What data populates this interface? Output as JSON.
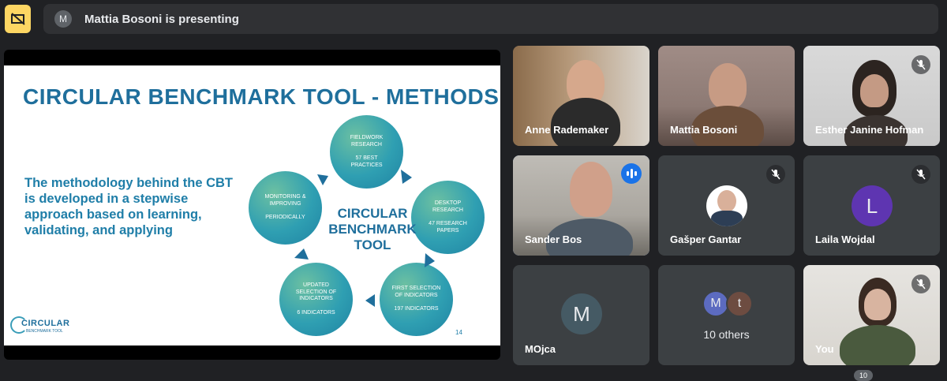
{
  "banner": {
    "avatar_letter": "M",
    "text": "Mattia Bosoni is presenting"
  },
  "slide": {
    "title": "CIRCULAR BENCHMARK TOOL - METHODS",
    "body": "The methodology behind the CBT is developed in a stepwise approach based on learning, validating, and applying",
    "center": [
      "CIRCULAR",
      "BENCHMARK",
      "TOOL"
    ],
    "page_number": "14",
    "logo_text": "CIRCULAR",
    "logo_sub": "BENCHMARK TOOL",
    "circles": {
      "fieldwork": [
        "FIELDWORK",
        "RESEARCH",
        "57 BEST",
        "PRACTICES"
      ],
      "desktop": [
        "DESKTOP",
        "RESEARCH",
        "47 RESEARCH",
        "PAPERS"
      ],
      "first": [
        "FIRST SELECTION",
        "OF INDICATORS",
        "197 INDICATORS"
      ],
      "updated": [
        "UPDATED",
        "SELECTION OF",
        "INDICATORS",
        "6 INDICATORS"
      ],
      "monitoring": [
        "MONITORING &",
        "IMPROVING",
        "PERIODICALLY"
      ]
    }
  },
  "participants": [
    {
      "name": "Anne Rademaker"
    },
    {
      "name": "Mattia Bosoni"
    },
    {
      "name": "Esther Janine Hofman"
    },
    {
      "name": "Sander Bos"
    },
    {
      "name": "Gašper Gantar"
    },
    {
      "name": "Laila Wojdal",
      "avatar_letter": "L",
      "avatar_color": "#5e35b1"
    },
    {
      "name": "MOjca",
      "avatar_letter": "M",
      "avatar_color": "#455a64"
    },
    {
      "name": "10 others",
      "avatars": [
        "M",
        "t"
      ],
      "avatar_colors": [
        "#5c6bc0",
        "#6d4c41"
      ]
    },
    {
      "name": "You"
    }
  ],
  "bottom_badge": "10"
}
